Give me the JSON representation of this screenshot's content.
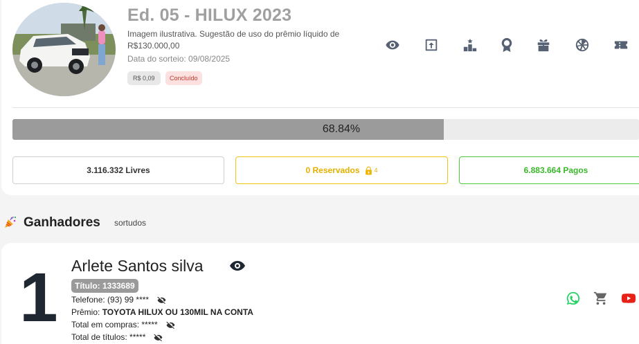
{
  "raffle": {
    "title": "Ed. 05 - HILUX 2023",
    "subtitle": "Imagem ilustrativa. Sugestão de uso do prêmio líquido de R$130.000,00",
    "draw_date": "Data do sorteio: 09/08/2025",
    "price": "R$ 0,09",
    "status": "Concluído",
    "image": "white-pickup-truck-with-woman"
  },
  "toolbar_icons": [
    "eye-icon",
    "share-icon",
    "podium-icon",
    "award-icon",
    "gift-icon",
    "wheel-icon",
    "ticket-icon"
  ],
  "progress": {
    "percent": 68.84,
    "label": "68.84%"
  },
  "stats": {
    "livres": "3.116.332 Livres",
    "reservados": "0 Reservados",
    "reserved_locks": "4",
    "pagos": "6.883.664 Pagos"
  },
  "winners_section": {
    "title": "Ganhadores",
    "subtitle": "sortudos"
  },
  "winner": {
    "rank": "1",
    "name": "Arlete Santos silva",
    "ticket": "Título: 1333689",
    "phone": "Telefone: (93) 99 ****",
    "prize_label": "Prêmio:",
    "prize_value": "TOYOTA HILUX OU 130MIL NA CONTA",
    "total_purchases": "Total em compras: *****",
    "total_tickets": "Total de títulos: *****"
  },
  "colors": {
    "stat_reserved": "#f0c419",
    "stat_paid": "#4ecb3a",
    "whatsapp": "#25d366",
    "youtube": "#e62117",
    "progress_fill": "#9b9b9b"
  }
}
